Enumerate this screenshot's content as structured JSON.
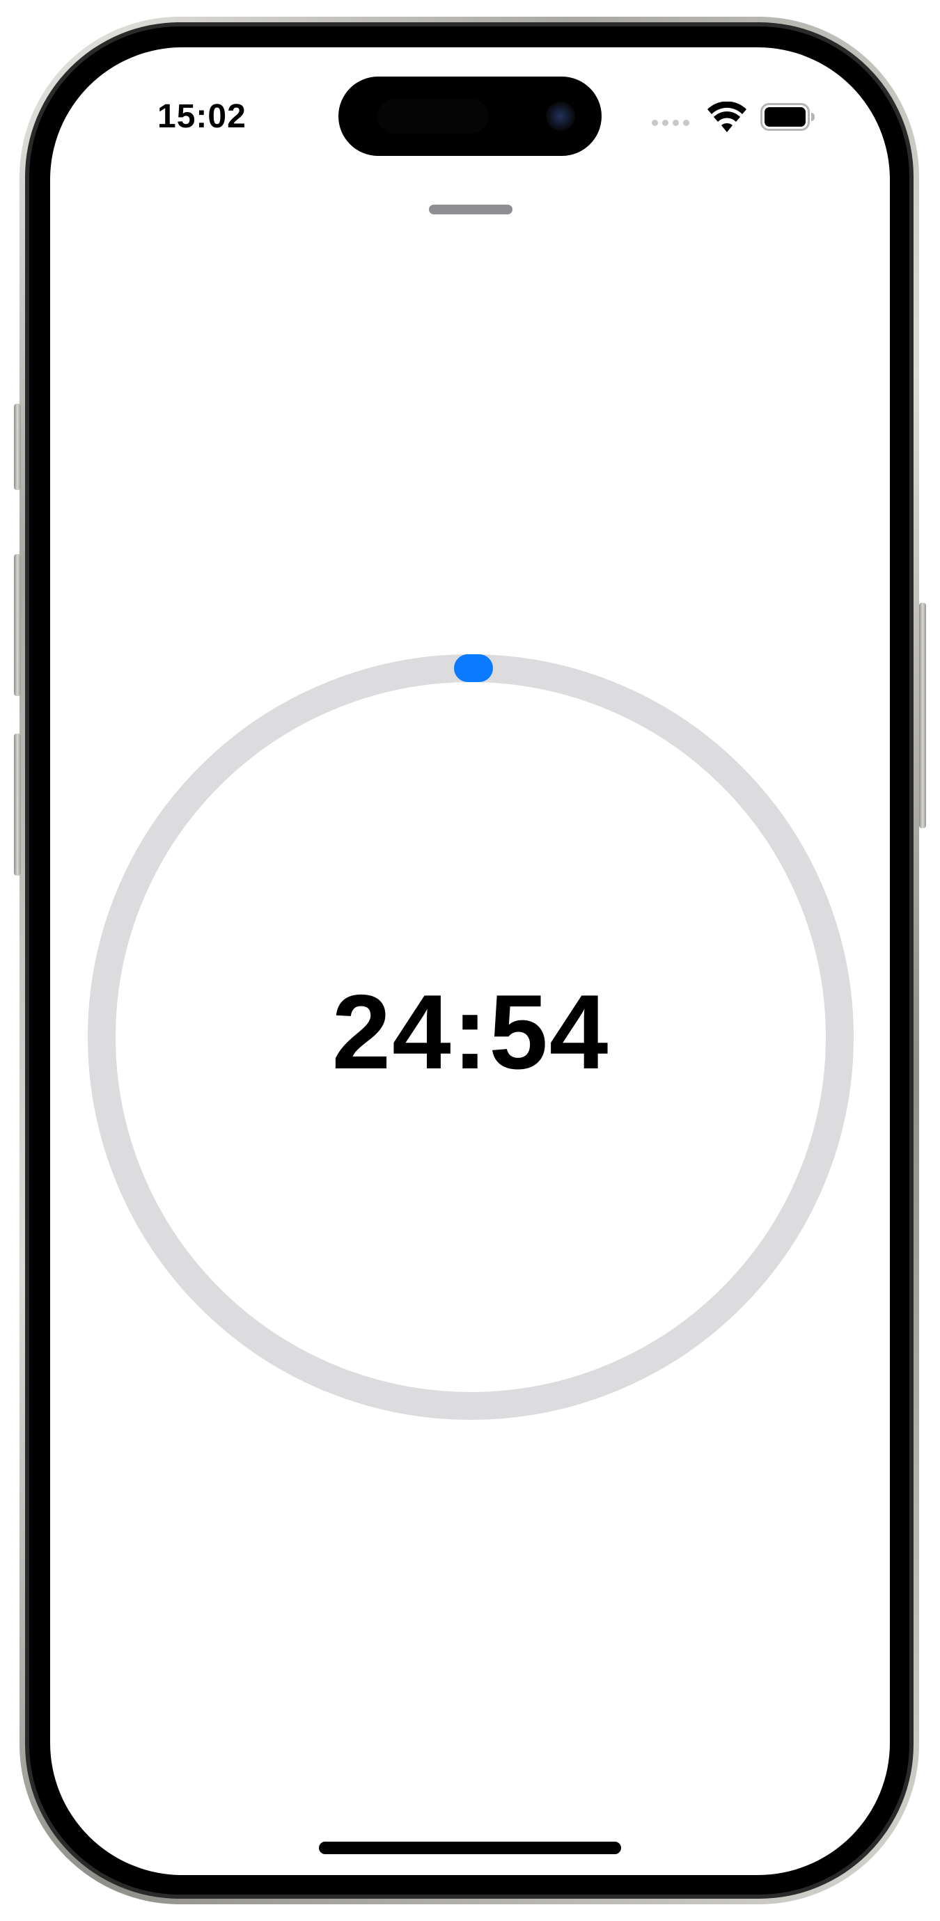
{
  "status_bar": {
    "time": "15:02",
    "icons": [
      "signal-icon",
      "wifi-icon",
      "battery-icon"
    ]
  },
  "timer": {
    "remaining": "24:54",
    "progress_fraction": 0.0,
    "track_color": "#dcdcdf",
    "thumb_color": "#0a7aff"
  },
  "colors": {
    "background": "#ffffff",
    "text": "#000000",
    "grabber": "#8e8e93"
  }
}
